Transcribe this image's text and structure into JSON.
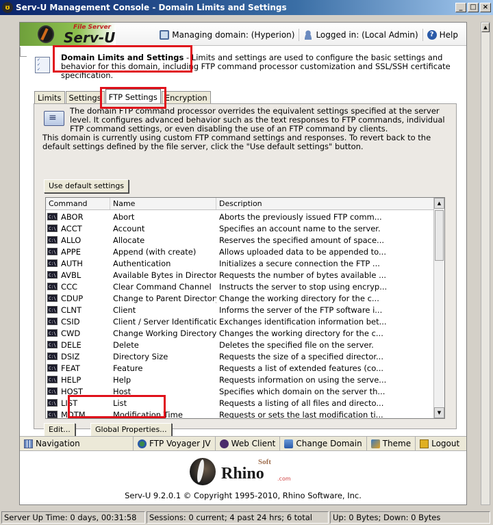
{
  "window": {
    "title": "Serv-U Management Console - Domain Limits and Settings",
    "app_icon": "ʊ"
  },
  "header": {
    "logo_sub": "File Server",
    "logo_main": "Serv-U",
    "managing_domain": "Managing domain: (Hyperion)",
    "logged_in": "Logged in: (Local Admin)",
    "help": "Help"
  },
  "section": {
    "title": "Domain Limits and Settings",
    "description": " - Limits and settings are used to configure the basic settings and behavior for this domain, including FTP command processor customization and SSL/SSH certificate specification."
  },
  "tabs": [
    {
      "label": "Limits"
    },
    {
      "label": "Settings"
    },
    {
      "label": "FTP Settings"
    },
    {
      "label": "Encryption"
    }
  ],
  "panel": {
    "info1": "The domain FTP command processor overrides the equivalent settings specified at the server level. It configures advanced behavior such as the text responses to FTP commands, individual FTP command settings, or even disabling the use of an FTP command by clients.",
    "info2": "This domain is currently using custom FTP command settings and responses. To revert back to the default settings defined by the file server, click the \"Use default settings\" button.",
    "use_default_button": "Use default settings",
    "edit_button": "Edit...",
    "global_button": "Global Properties..."
  },
  "table": {
    "headers": [
      "Command",
      "Name",
      "Description"
    ],
    "rows": [
      {
        "cmd": "ABOR",
        "name": "Abort",
        "desc": "Aborts the previously issued FTP comm..."
      },
      {
        "cmd": "ACCT",
        "name": "Account",
        "desc": "Specifies an account name to the server."
      },
      {
        "cmd": "ALLO",
        "name": "Allocate",
        "desc": "Reserves the specified amount of space..."
      },
      {
        "cmd": "APPE",
        "name": "Append (with create)",
        "desc": "Allows uploaded data to be appended to..."
      },
      {
        "cmd": "AUTH",
        "name": "Authentication",
        "desc": "Initializes a secure connection the FTP ..."
      },
      {
        "cmd": "AVBL",
        "name": "Available Bytes in Directory",
        "desc": "Requests the number of bytes available ..."
      },
      {
        "cmd": "CCC",
        "name": "Clear Command Channel",
        "desc": "Instructs the server to stop using encryp..."
      },
      {
        "cmd": "CDUP",
        "name": "Change to Parent Directory",
        "desc": "Change the working directory for the c..."
      },
      {
        "cmd": "CLNT",
        "name": "Client",
        "desc": "Informs the server of the FTP software i..."
      },
      {
        "cmd": "CSID",
        "name": "Client / Server Identification",
        "desc": "Exchanges identification information bet..."
      },
      {
        "cmd": "CWD",
        "name": "Change Working Directory",
        "desc": "Changes the working directory for the c..."
      },
      {
        "cmd": "DELE",
        "name": "Delete",
        "desc": "Deletes the specified file on the server."
      },
      {
        "cmd": "DSIZ",
        "name": "Directory Size",
        "desc": "Requests the size of a specified director..."
      },
      {
        "cmd": "FEAT",
        "name": "Feature",
        "desc": "Requests a list of extended features (co..."
      },
      {
        "cmd": "HELP",
        "name": "Help",
        "desc": "Requests information on using the serve..."
      },
      {
        "cmd": "HOST",
        "name": "Host",
        "desc": "Specifies which domain on the server th..."
      },
      {
        "cmd": "LIST",
        "name": "List",
        "desc": "Requests a listing of all files and directo..."
      },
      {
        "cmd": "MDTM",
        "name": "Modification Time",
        "desc": "Requests or sets the last modification ti..."
      }
    ]
  },
  "navbar": {
    "navigation": "Navigation",
    "ftp_voyager": "FTP Voyager JV",
    "web_client": "Web Client",
    "change_domain": "Change Domain",
    "theme": "Theme",
    "logout": "Logout"
  },
  "footer": {
    "brand": "Rhino",
    "brand_soft": "Soft",
    "brand_com": ".com",
    "copyright": "Serv-U 9.2.0.1 © Copyright 1995-2010, Rhino Software, Inc."
  },
  "status": {
    "uptime": "Server Up Time: 0 days, 00:31:58",
    "sessions": "Sessions: 0 current; 4 past 24 hrs; 6 total",
    "traffic": "Up: 0 Bytes; Down: 0 Bytes"
  },
  "colors": {
    "highlight": "#e0101a",
    "title_bar": "#0a246a",
    "logo_green": "#8dc04f"
  }
}
